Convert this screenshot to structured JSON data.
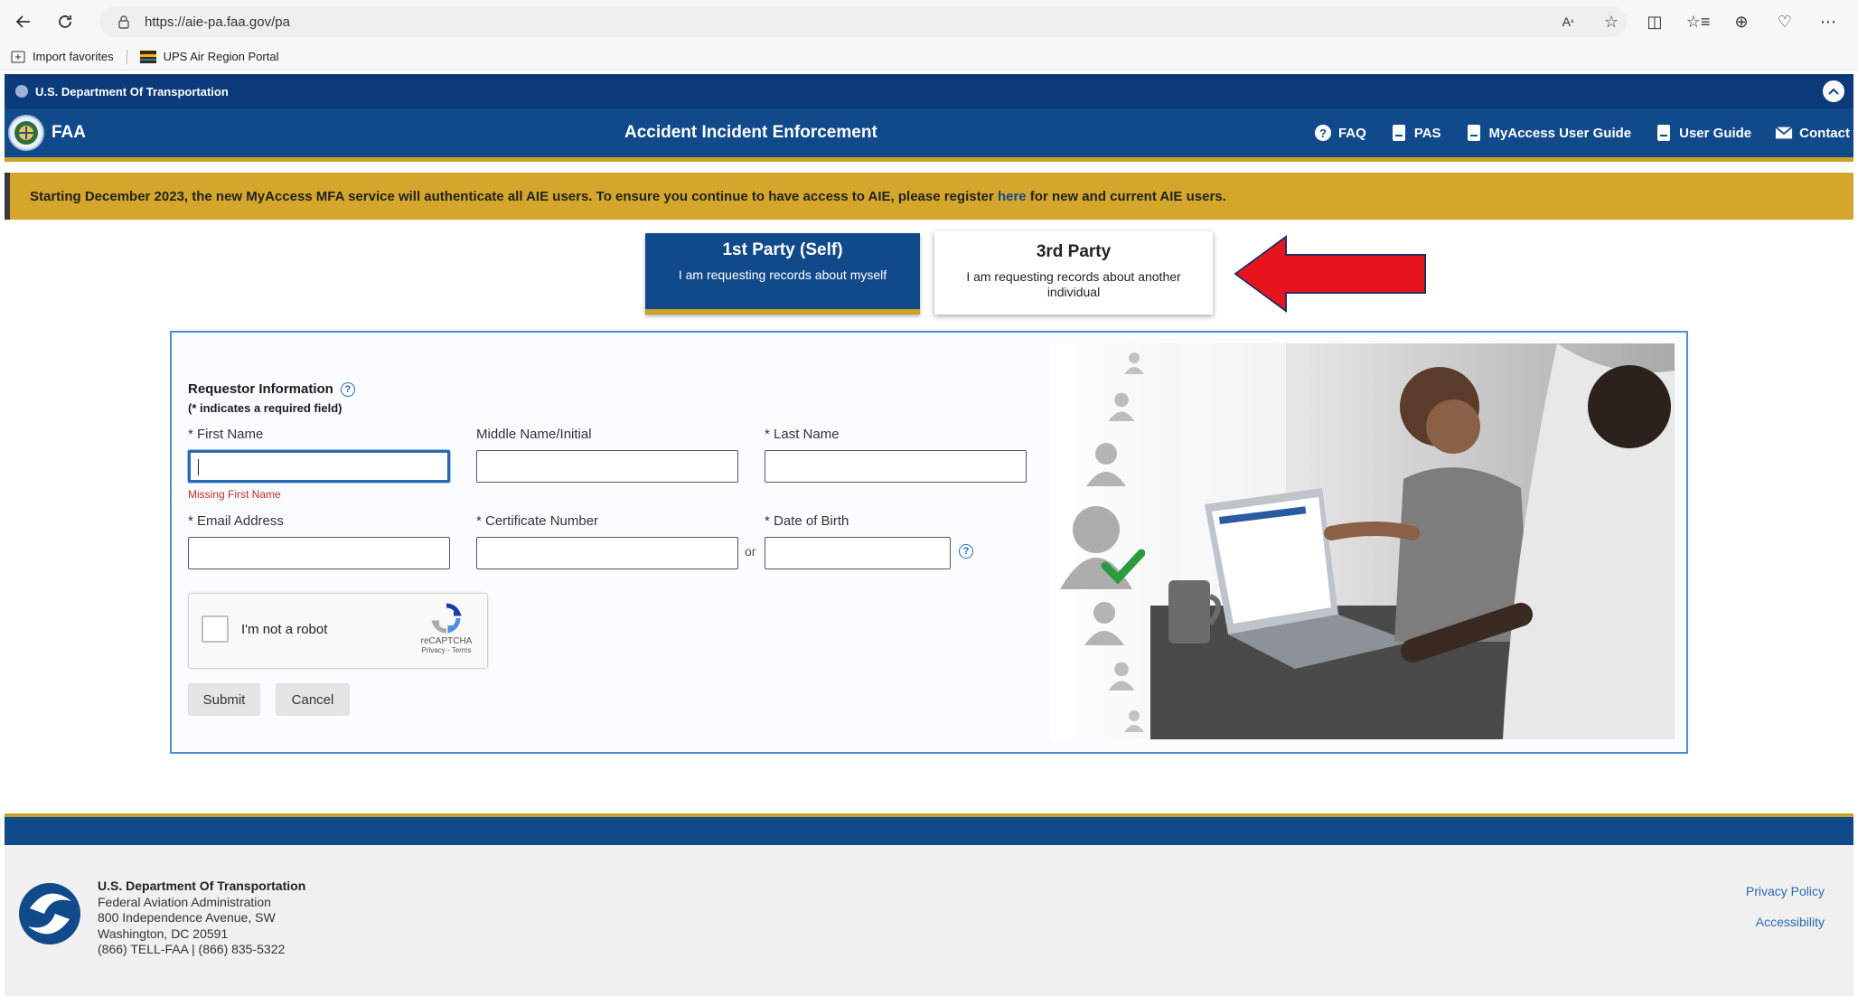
{
  "browser": {
    "url": "https://aie-pa.faa.gov/pa",
    "favorites": [
      {
        "label": "Import favorites"
      },
      {
        "label": "UPS Air Region Portal"
      }
    ]
  },
  "banner": {
    "agency": "U.S. Department Of Transportation"
  },
  "header": {
    "logo_text": "FAA",
    "title": "Accident Incident Enforcement",
    "nav": [
      {
        "label": "FAQ",
        "icon": "question-circle-icon"
      },
      {
        "label": "PAS",
        "icon": "document-icon"
      },
      {
        "label": "MyAccess User Guide",
        "icon": "document-icon"
      },
      {
        "label": "User Guide",
        "icon": "document-icon"
      },
      {
        "label": "Contact",
        "icon": "envelope-icon"
      }
    ]
  },
  "notice": {
    "text_before": "Starting December 2023, the new MyAccess MFA service will authenticate all AIE users. To ensure you continue to have access to AIE, please register ",
    "link": "here",
    "text_after": " for new and current AIE users."
  },
  "tabs": {
    "self": {
      "title": "1st Party (Self)",
      "subtitle": "I am requesting records about myself"
    },
    "third": {
      "title": "3rd Party",
      "subtitle": "I am requesting records about another individual"
    }
  },
  "form": {
    "section_title": "Requestor Information",
    "required_note": "(* indicates a required field)",
    "fields": {
      "first_name": {
        "label": "* First Name",
        "value": ""
      },
      "middle_name": {
        "label": "Middle Name/Initial",
        "value": ""
      },
      "last_name": {
        "label": "* Last Name",
        "value": ""
      },
      "email": {
        "label": "* Email Address",
        "value": ""
      },
      "certificate": {
        "label": "* Certificate Number",
        "value": ""
      },
      "dob": {
        "label": "* Date of Birth",
        "value": ""
      }
    },
    "error_first_name": "Missing First Name",
    "or_text": "or",
    "captcha": {
      "label": "I'm not a robot",
      "brand": "reCAPTCHA",
      "terms": "Privacy - Terms"
    },
    "submit_label": "Submit",
    "cancel_label": "Cancel"
  },
  "footer": {
    "org": "U.S. Department Of Transportation",
    "agency": "Federal Aviation Administration",
    "street": "800 Independence Avenue, SW",
    "city": "Washington, DC 20591",
    "phone": "(866) TELL-FAA | (866) 835-5322",
    "links": [
      "Privacy Policy",
      "Accessibility"
    ]
  },
  "colors": {
    "navy": "#114a8b",
    "gold": "#d4a72c",
    "arrow_red": "#e8141c"
  }
}
